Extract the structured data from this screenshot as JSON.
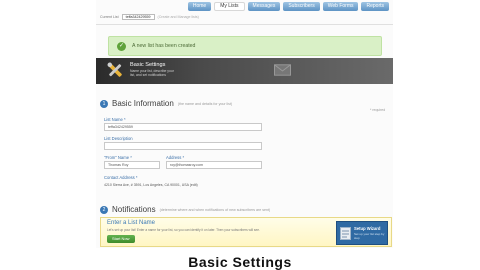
{
  "nav": {
    "tabs": [
      "Home",
      "My Lists",
      "Messages",
      "Subscribers",
      "Web Forms",
      "Reports"
    ],
    "active_index": 1
  },
  "account": {
    "label": "Current List",
    "selected": "teffa342429559",
    "hint": "(Create and Manage lists)"
  },
  "notice": {
    "text": "A new list has been created"
  },
  "banner": {
    "title": "Basic Settings",
    "description": "Name your list, describe your list, and set notifications"
  },
  "basic": {
    "number": "1",
    "title": "Basic Information",
    "subtitle": "(the name and details for your list)",
    "required_note": "* required",
    "list_name_label": "List Name *",
    "list_name_value": "teffa342429559",
    "list_description_label": "List Description",
    "list_description_value": "",
    "from_name_label": "\"From\" Name *",
    "from_name_value": "Thomas Roy",
    "email_label": "Address *",
    "email_value": "roy@thomasroy.com",
    "contact_label": "Contact Address *",
    "contact_value": "4210 Sierra Ave, # 3591, Los Angeles, CA 90001, USA (edit)"
  },
  "notifications": {
    "number": "2",
    "title": "Notifications",
    "subtitle": "(determine where and when notifications of new subscribers are sent)"
  },
  "promo": {
    "title": "Enter a List Name",
    "description": "Let's set up your list! Enter a name for your list, so you can identify it on later. Then your subscribers will see.",
    "button": "Start Now",
    "wizard_title": "Setup Wizard",
    "wizard_sub": "Set up your list step by step"
  },
  "caption": "Basic Settings",
  "colors": {
    "accent_blue": "#3a78b5",
    "success_green": "#5fa33a",
    "banner_dark": "#2b2b2b"
  }
}
